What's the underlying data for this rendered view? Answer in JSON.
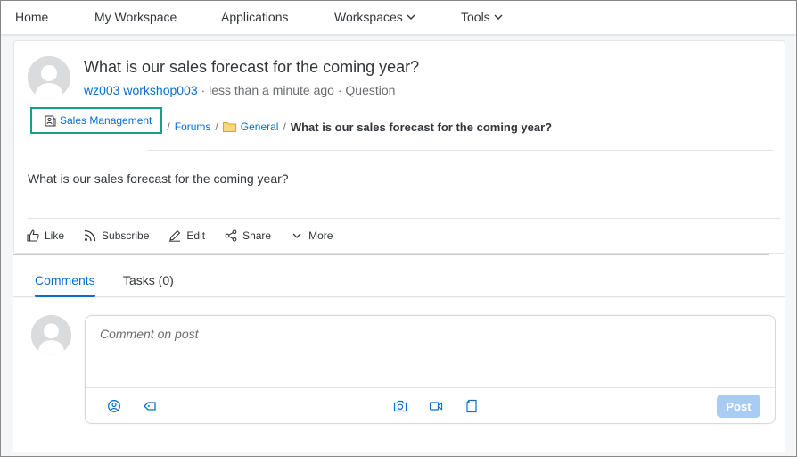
{
  "nav": {
    "home": "Home",
    "my_workspace": "My Workspace",
    "applications": "Applications",
    "workspaces": "Workspaces",
    "tools": "Tools"
  },
  "post": {
    "title": "What is our sales forecast for the coming year?",
    "author": "wz003 workshop003",
    "time": "less than a minute ago",
    "type": "Question",
    "body": "What is our sales forecast for the coming year?"
  },
  "breadcrumb": {
    "group": "Sales Management",
    "forums": "Forums",
    "folder": "General",
    "current": "What is our sales forecast for the coming year?",
    "separator": "/"
  },
  "actions": {
    "like": "Like",
    "subscribe": "Subscribe",
    "edit": "Edit",
    "share": "Share",
    "more": "More"
  },
  "tabs": {
    "comments": "Comments",
    "tasks": "Tasks (0)"
  },
  "comment": {
    "placeholder": "Comment on post",
    "post_label": "Post"
  },
  "colors": {
    "link": "#0a6ed1",
    "highlight_border": "#16a085",
    "post_button": "#a9cdf2"
  }
}
